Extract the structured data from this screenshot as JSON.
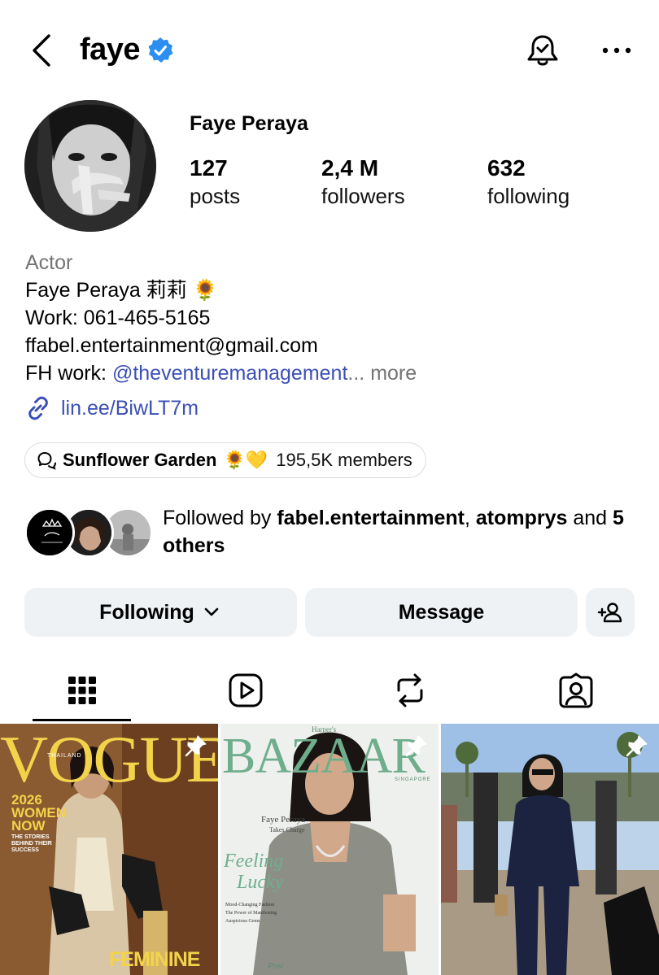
{
  "header": {
    "username": "faye",
    "icons": {
      "back": "back-chevron-icon",
      "verified": "verified-badge-icon",
      "notifications": "notification-bell-icon",
      "more": "more-options-icon"
    }
  },
  "profile": {
    "display_name": "Faye Peraya",
    "stats": [
      {
        "number": "127",
        "label": "posts"
      },
      {
        "number": "2,4 M",
        "label": "followers"
      },
      {
        "number": "632",
        "label": "following"
      }
    ],
    "bio": {
      "category": "Actor",
      "line1": "Faye Peraya 莉莉 🌻",
      "line2": "Work: 061-465-5165",
      "line3": "ffabel.entertainment@gmail.com",
      "line4_prefix": "FH work: ",
      "line4_mention": "@theventuremanagement",
      "line4_ellipsis": "...",
      "more_label": " more"
    },
    "link": {
      "text": "lin.ee/BiwLT7m",
      "icon": "link-icon"
    }
  },
  "channel": {
    "name": "Sunflower Garden",
    "emoji": "🌻💛",
    "members": "195,5K members",
    "icon": "broadcast-channel-icon"
  },
  "followed_by": {
    "prefix": "Followed by ",
    "user1": "fabel.entertainment",
    "separator": ", ",
    "user2": "atomprys",
    "middle": " and ",
    "others": "5 others"
  },
  "actions": {
    "following_label": "Following",
    "message_label": "Message",
    "add_friend_icon": "add-person-icon"
  },
  "tabs": [
    {
      "icon": "grid-icon",
      "active": true
    },
    {
      "icon": "reels-icon",
      "active": false
    },
    {
      "icon": "reposts-icon",
      "active": false
    },
    {
      "icon": "tagged-icon",
      "active": false
    }
  ],
  "posts": [
    {
      "masthead": "VOGUE",
      "edition": "THAILAND",
      "cover_line1": "2026",
      "cover_line2": "WOMEN",
      "cover_line3": "NOW",
      "cover_line4": "THE STORIES",
      "cover_line5": "BEHIND THEIR",
      "cover_line6": "SUCCESS",
      "bottom_text": "FEMININE",
      "pinned": true
    },
    {
      "masthead_small": "Harper's",
      "masthead": "BAZAAR",
      "edition": "SINGAPORE",
      "feature_name": "Faye Peraya",
      "feature_sub": "Takes Charge",
      "headline1": "Feeling",
      "headline2": "Lucky",
      "teaser1": "Mood-Changing Fashion",
      "teaser2": "The Power of Manifesting",
      "teaser3": "Auspicious Gems",
      "bottom_text": "Post",
      "pinned": true
    },
    {
      "pinned": true
    }
  ],
  "colors": {
    "link": "#3b4fb5",
    "muted": "#737373",
    "button_bg": "#eef2f5",
    "verified": "#2c8ef0"
  }
}
